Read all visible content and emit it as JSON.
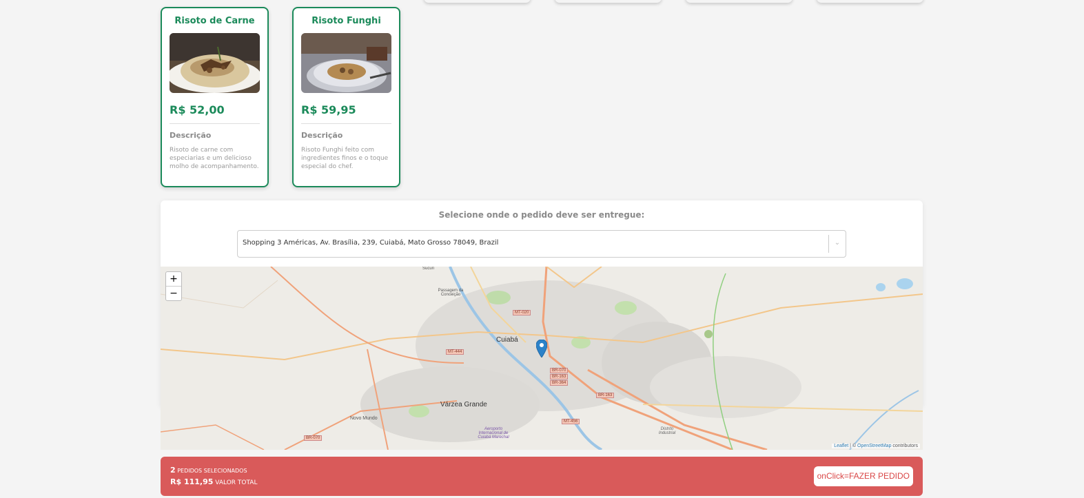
{
  "products": [
    {
      "name": "Risoto de Carne",
      "price": "R$ 52,00",
      "desc_label": "Descrição",
      "desc": "Risoto de carne com especiarias e um delicioso molho de acompanhamento."
    },
    {
      "name": "Risoto Funghi",
      "price": "R$ 59,95",
      "desc_label": "Descrição",
      "desc": "Risoto Funghi feito com ingredientes finos e o toque especial do chef."
    }
  ],
  "delivery": {
    "heading": "Selecione onde o pedido deve ser entregue:",
    "address": "Shopping 3 Américas, Av. Brasília, 239, Cuiabá, Mato Grosso 78049, Brazil"
  },
  "map": {
    "zoom_in": "+",
    "zoom_out": "−",
    "labels": {
      "cuiaba": "Cuiabá",
      "varzea": "Várzea Grande",
      "novo_mundo": "Novo Mundo",
      "passagem": "Passagem da Conceição",
      "sucuri": "Sucuri",
      "aeroporto": "Aeroporto Internacional de Cuiabá Marechal",
      "distrito": "Distrito Industrial",
      "mt020": "MT-020",
      "mt444": "MT-444",
      "br070": "BR-070",
      "br163": "BR-163",
      "br364": "BR-364",
      "mt456": "MT-456"
    },
    "attribution": {
      "leaflet": "Leaflet",
      "sep": " | © ",
      "osm": "OpenStreetMap",
      "contrib": " contributors"
    }
  },
  "summary": {
    "count": "2",
    "count_label": "PEDIDOS SELECIONADOS",
    "total": "R$ 111,95",
    "total_label": "VALOR TOTAL",
    "button": "onClick=FAZER PEDIDO"
  },
  "colors": {
    "accent": "#1b8a5a",
    "bar": "#d95a5a",
    "marker": "#2c82c9"
  }
}
